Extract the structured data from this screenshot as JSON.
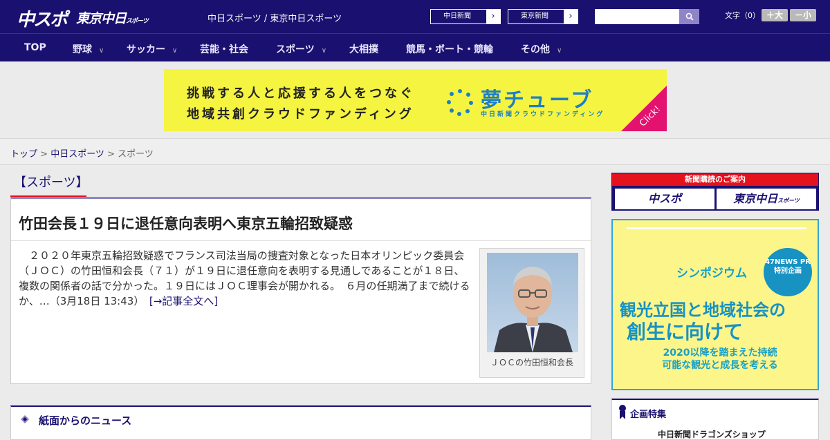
{
  "header": {
    "logo_main": "中スポ",
    "logo_tokyo": "東京中日",
    "logo_tokyo_small": "スポーツ",
    "site_links": "中日スポーツ / 東京中日スポーツ",
    "link_chunichi": "中日新聞",
    "link_tokyo": "東京新聞",
    "search_placeholder": "",
    "font_label": "文字（0）",
    "font_larger": "＋大",
    "font_smaller": "－小"
  },
  "nav": {
    "items": [
      {
        "label": "TOP",
        "has_menu": false
      },
      {
        "label": "野球",
        "has_menu": true
      },
      {
        "label": "サッカー",
        "has_menu": true
      },
      {
        "label": "芸能・社会",
        "has_menu": false
      },
      {
        "label": "スポーツ",
        "has_menu": true
      },
      {
        "label": "大相撲",
        "has_menu": false
      },
      {
        "label": "競馬・ボート・競輪",
        "has_menu": false
      },
      {
        "label": "その他",
        "has_menu": true
      }
    ]
  },
  "banner": {
    "line1": "挑戦する人と応援する人をつなぐ",
    "line2": "地域共創クラウドファンディング",
    "brand": "夢チューブ",
    "brand_sub": "中日新聞クラウドファンディング",
    "click": "Click!"
  },
  "breadcrumb": {
    "top": "トップ",
    "sep": " > ",
    "parent": "中日スポーツ",
    "current": "スポーツ"
  },
  "section_title": "【スポーツ】",
  "article": {
    "title": "竹田会長１９日に退任意向表明へ東京五輪招致疑惑",
    "body": "２０２０年東京五輪招致疑惑でフランス司法当局の捜査対象となった日本オリンピック委員会（ＪＯＣ）の竹田恒和会長（７１）が１９日に退任意向を表明する見通しであることが１８日、複数の関係者の話で分かった。１９日にはＪＯＣ理事会が開かれる。　６月の任期満了まで続けるか、…（3月18日 13:43）",
    "read_more": "[→記事全文へ]",
    "photo_caption": "ＪＯＣの竹田恒和会長"
  },
  "news_section": {
    "title": "紙面からのニュース"
  },
  "sidebar": {
    "subscribe_header": "新聞購読のご案内",
    "sub_chuspo": "中スポ",
    "sub_tokyo": "東京中日",
    "sub_tokyo_small": "スポーツ",
    "ad": {
      "symposium": "シンポジウム",
      "main1": "観光立国と地域社会の",
      "main2": "創生に向けて",
      "sub": "2020以降を踏まえた持続可能な観光と成長を考える",
      "badge": "47NEWS PR 特別企画"
    },
    "kikaku_title": "企画特集",
    "kikaku_item": "中日新聞ドラゴンズショップ"
  }
}
